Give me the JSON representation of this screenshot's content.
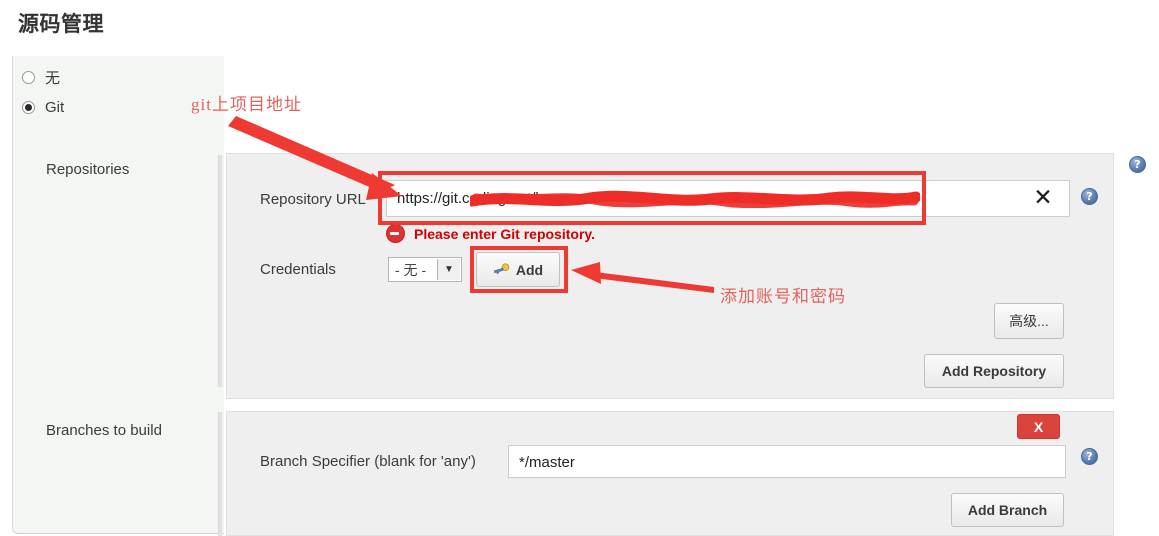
{
  "page": {
    "title": "源码管理"
  },
  "scm_type": {
    "options": [
      {
        "label": "无",
        "selected": false
      },
      {
        "label": "Git",
        "selected": true
      }
    ]
  },
  "sections": {
    "repositories_label": "Repositories",
    "branches_label": "Branches to build"
  },
  "repository": {
    "url_label": "Repository URL",
    "url_value": "https://git.coding.net/k",
    "url_clear_icon": "✕",
    "error_message": "Please enter Git repository.",
    "credentials_label": "Credentials",
    "credentials_value": "- 无 -",
    "credentials_caret": "▼",
    "add_credentials_label": "Add",
    "advanced_label": "高级...",
    "add_repository_label": "Add Repository"
  },
  "branch": {
    "specifier_label": "Branch Specifier (blank for 'any')",
    "specifier_value": "*/master",
    "delete_label": "X",
    "add_branch_label": "Add Branch"
  },
  "help": {
    "glyph": "?"
  },
  "annotations": {
    "url_note": "git上项目地址",
    "credentials_note": "添加账号和密码",
    "accent_color": "#ef3a34",
    "note_color": "#e0635f"
  }
}
